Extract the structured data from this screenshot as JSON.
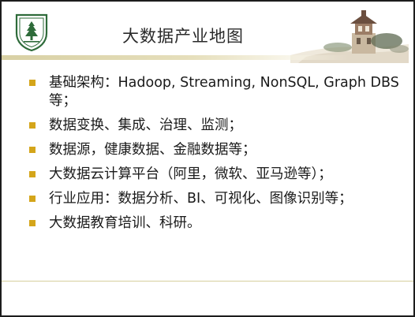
{
  "slide": {
    "title": "大数据产业地图",
    "bullets": [
      "基础架构：Hadoop, Streaming, NonSQL, Graph DBS等；",
      "数据变换、集成、治理、监测；",
      "数据源，健康数据、金融数据等；",
      "大数据云计算平台（阿里，微软、亚马逊等）；",
      "行业应用：数据分析、BI、可视化、图像识别等；",
      "大数据教育培训、科研。"
    ]
  },
  "colors": {
    "bullet_marker": "#d4a51a",
    "logo_green": "#2e6b3a",
    "accent_line": "#d8d0a4"
  },
  "icons": {
    "logo": "university-emblem-icon",
    "header_image": "tower-illustration"
  }
}
